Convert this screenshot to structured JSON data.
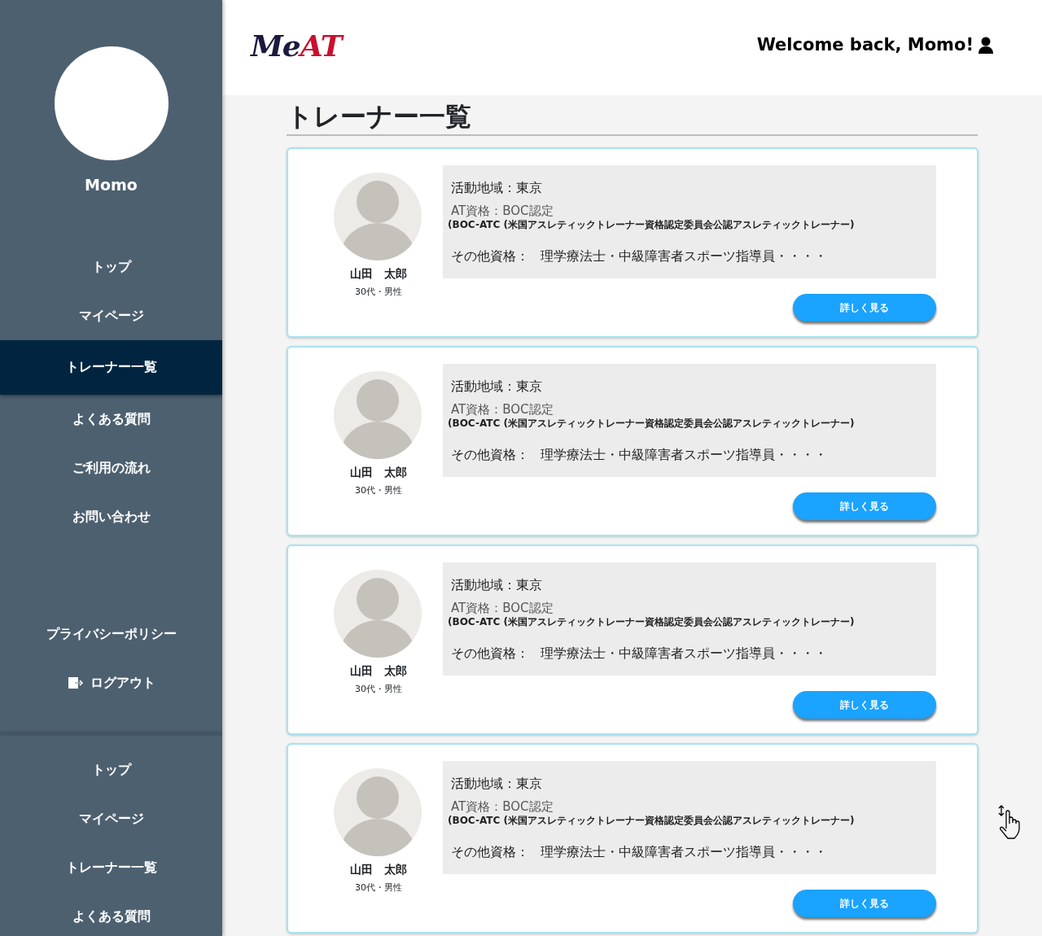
{
  "sidebar": {
    "user_name": "Momo",
    "nav": [
      {
        "label": "トップ",
        "selected": false
      },
      {
        "label": "マイページ",
        "selected": false
      },
      {
        "label": "トレーナー一覧",
        "selected": true
      },
      {
        "label": "よくある質問",
        "selected": false
      },
      {
        "label": "ご利用の流れ",
        "selected": false
      },
      {
        "label": "お問い合わせ",
        "selected": false
      }
    ],
    "secondary": [
      {
        "label": "プライバシーポリシー",
        "kind": "link"
      },
      {
        "label": "ログアウト",
        "kind": "logout"
      }
    ],
    "nav_repeat": [
      {
        "label": "トップ",
        "selected": false
      },
      {
        "label": "マイページ",
        "selected": false
      },
      {
        "label": "トレーナー一覧",
        "selected": false
      },
      {
        "label": "よくある質問",
        "selected": false
      }
    ]
  },
  "header": {
    "logo": [
      {
        "text": "Me",
        "color": "#1a1a40"
      },
      {
        "text": "AT",
        "color": "#c8102e"
      }
    ],
    "welcome": "Welcome back, Momo!"
  },
  "page_title": "トレーナー一覧",
  "trainers": [
    {
      "name": "山田　太郎",
      "age_gender": "30代・男性",
      "region": "活動地域：東京",
      "at_cert": "AT資格：BOC認定",
      "cert_detail": "(BOC-ATC (米国アスレティックトレーナー資格認定委員会公認アスレティックトレーナー)",
      "other_label": "その他資格：",
      "other_value": "理学療法士・中級障害者スポーツ指導員・・・・",
      "button": "詳しく見る"
    },
    {
      "name": "山田　太郎",
      "age_gender": "30代・男性",
      "region": "活動地域：東京",
      "at_cert": "AT資格：BOC認定",
      "cert_detail": "(BOC-ATC (米国アスレティックトレーナー資格認定委員会公認アスレティックトレーナー)",
      "other_label": "その他資格：",
      "other_value": "理学療法士・中級障害者スポーツ指導員・・・・",
      "button": "詳しく見る"
    },
    {
      "name": "山田　太郎",
      "age_gender": "30代・男性",
      "region": "活動地域：東京",
      "at_cert": "AT資格：BOC認定",
      "cert_detail": "(BOC-ATC (米国アスレティックトレーナー資格認定委員会公認アスレティックトレーナー)",
      "other_label": "その他資格：",
      "other_value": "理学療法士・中級障害者スポーツ指導員・・・・",
      "button": "詳しく見る"
    },
    {
      "name": "山田　太郎",
      "age_gender": "30代・男性",
      "region": "活動地域：東京",
      "at_cert": "AT資格：BOC認定",
      "cert_detail": "(BOC-ATC (米国アスレティックトレーナー資格認定委員会公認アスレティックトレーナー)",
      "other_label": "その他資格：",
      "other_value": "理学療法士・中級障害者スポーツ指導員・・・・",
      "button": "詳しく見る"
    }
  ]
}
